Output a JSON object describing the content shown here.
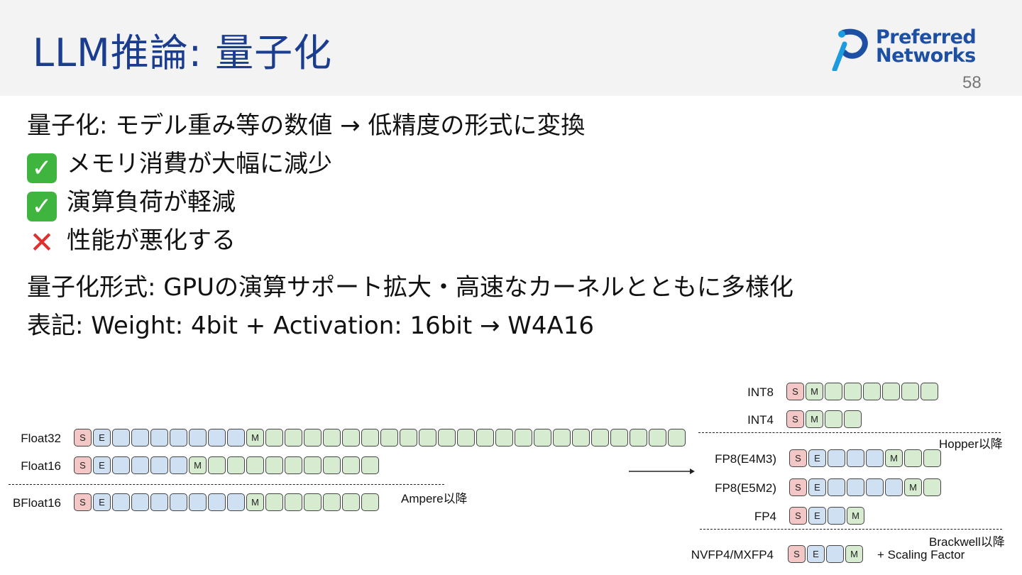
{
  "header": {
    "title": "LLM推論: 量子化",
    "logo_line1": "Preferred",
    "logo_line2": "Networks",
    "page_number": "58"
  },
  "colors": {
    "title": "#1a3d8f",
    "sign": "#f4c7c7",
    "exponent": "#cfe0f3",
    "mantissa": "#d6ebd0",
    "check": "#3fb53f",
    "cross": "#e0302e"
  },
  "body_lines": [
    {
      "icon": "",
      "text": "量子化: モデル重み等の数値 → 低精度の形式に変換"
    },
    {
      "icon": "check-mark-icon",
      "text": "メモリ消費が大幅に減少"
    },
    {
      "icon": "check-mark-icon",
      "text": "演算負荷が軽減"
    },
    {
      "icon": "cross-mark-icon",
      "text": "性能が悪化する"
    },
    {
      "icon": "",
      "text": "量子化形式: GPUの演算サポート拡大・高速なカーネルとともに多様化"
    },
    {
      "icon": "",
      "text": "表記: Weight: 4bit + Activation: 16bit → W4A16"
    }
  ],
  "diagram": {
    "bit_labels": {
      "sign": "S",
      "exponent": "E",
      "mantissa": "M"
    },
    "formats": [
      {
        "name": "Float32",
        "sign": 1,
        "exponent": 8,
        "mantissa": 23
      },
      {
        "name": "Float16",
        "sign": 1,
        "exponent": 5,
        "mantissa": 10
      },
      {
        "name": "BFloat16",
        "sign": 1,
        "exponent": 8,
        "mantissa": 7
      },
      {
        "name": "INT8",
        "sign": 1,
        "exponent": 0,
        "mantissa": 7
      },
      {
        "name": "INT4",
        "sign": 1,
        "exponent": 0,
        "mantissa": 3
      },
      {
        "name": "FP8(E4M3)",
        "sign": 1,
        "exponent": 4,
        "mantissa": 3
      },
      {
        "name": "FP8(E5M2)",
        "sign": 1,
        "exponent": 5,
        "mantissa": 2
      },
      {
        "name": "FP4",
        "sign": 1,
        "exponent": 2,
        "mantissa": 1
      },
      {
        "name": "NVFP4/MXFP4",
        "sign": 1,
        "exponent": 2,
        "mantissa": 1
      }
    ],
    "separators": {
      "ampere": "Ampere以降",
      "hopper": "Hopper以降",
      "blackwell": "Brackwell以降"
    },
    "scaling_note": "+  Scaling Factor"
  }
}
